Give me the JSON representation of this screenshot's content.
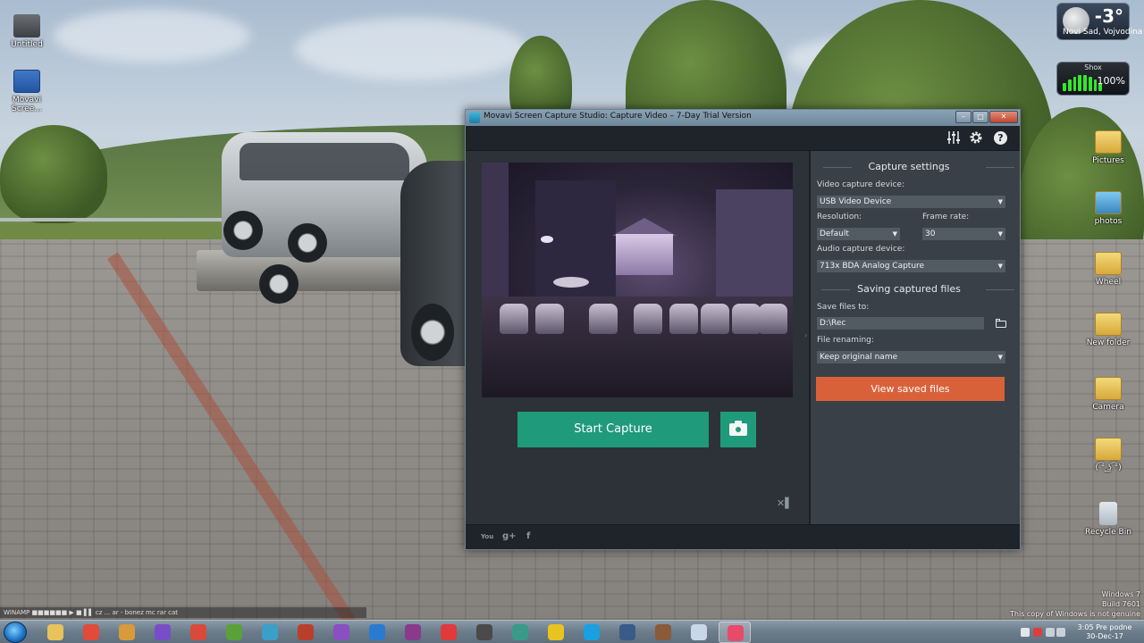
{
  "desktop": {
    "icons_left": [
      {
        "label": "Untitled",
        "kind": "shortcut"
      },
      {
        "label": "Movavi Scree...",
        "kind": "shortcut"
      }
    ],
    "icons_right": [
      {
        "label": "Pictures",
        "kind": "folder"
      },
      {
        "label": "photos",
        "kind": "folder"
      },
      {
        "label": "Wheel",
        "kind": "folder"
      },
      {
        "label": "New folder",
        "kind": "folder"
      },
      {
        "label": "Camera",
        "kind": "folder"
      },
      {
        "label": "( ͡° ͜ʖ ͡°)",
        "kind": "folder"
      },
      {
        "label": "Recycle Bin",
        "kind": "bin"
      }
    ]
  },
  "gadgets": {
    "weather": {
      "temp": "-3°",
      "city": "Novi Sad, Vojvodina"
    },
    "shox": {
      "title": "Shox",
      "level_percent": 100,
      "label": "100%"
    }
  },
  "window": {
    "title": "Movavi Screen Capture Studio: Capture Video – 7-Day Trial Version",
    "controls": {
      "minimize": "–",
      "maximize": "□",
      "close": "✕"
    },
    "toolbar_icons": [
      "equalizer-icon",
      "gear-icon",
      "help-icon"
    ],
    "help_glyph": "?",
    "preview": {
      "controls": {
        "start_capture": "Start Capture"
      }
    },
    "capture_settings": {
      "title": "Capture settings",
      "video_device_label": "Video capture device:",
      "video_device_value": "USB Video Device",
      "resolution_label": "Resolution:",
      "resolution_value": "Default",
      "frame_rate_label": "Frame rate:",
      "frame_rate_value": "30",
      "audio_device_label": "Audio capture device:",
      "audio_device_value": "713x BDA Analog Capture"
    },
    "saving": {
      "title": "Saving captured files",
      "save_to_label": "Save files to:",
      "save_to_value": "D:\\Rec",
      "renaming_label": "File renaming:",
      "renaming_value": "Keep original name",
      "view_saved": "View saved files"
    },
    "status_icons": [
      "youtube-icon",
      "google-plus-icon",
      "facebook-icon"
    ],
    "status_glyphs": {
      "youtube": "You",
      "google_plus": "g+",
      "facebook": "f"
    },
    "collapse_glyph": "✕▌",
    "splitter_glyph": "›",
    "dropdown_arrow": "▼"
  },
  "taskbar": {
    "ghost_text": "WINAMP   ■■■■■■   ▶  ■  ▌▌        cz ... ar - bonez mc rar cat",
    "clock_time": "3:05 Pre podne",
    "clock_date": "30-Dec-17",
    "genuine_lines": [
      "Windows 7",
      "Build 7601",
      "This copy of Windows is not genuine"
    ],
    "apps": [
      {
        "name": "explorer-icon",
        "color": "#e8c25a"
      },
      {
        "name": "chrome-icon",
        "color": "#e24a3b"
      },
      {
        "name": "tool-icon",
        "color": "#d89a3a"
      },
      {
        "name": "viber-icon",
        "color": "#7a4dc8"
      },
      {
        "name": "popcorn-icon",
        "color": "#d94a3a"
      },
      {
        "name": "utorrent-icon",
        "color": "#5aa13a"
      },
      {
        "name": "xbox-icon",
        "color": "#3aa0c8"
      },
      {
        "name": "game-icon",
        "color": "#b8402a"
      },
      {
        "name": "y-app-icon",
        "color": "#8a4fc0"
      },
      {
        "name": "lightning-icon",
        "color": "#2a7ad0"
      },
      {
        "name": "winrar-icon",
        "color": "#8a3a8a"
      },
      {
        "name": "speed-icon",
        "color": "#e03a3a"
      },
      {
        "name": "ark-icon",
        "color": "#4a4a4a"
      },
      {
        "name": "media-icon",
        "color": "#3a9a8a"
      },
      {
        "name": "radiation-icon",
        "color": "#e8c420"
      },
      {
        "name": "skype-icon",
        "color": "#1aa0e0"
      },
      {
        "name": "monitor-icon",
        "color": "#3a5a8a"
      },
      {
        "name": "face-icon",
        "color": "#8a5a3a"
      },
      {
        "name": "paint-icon",
        "color": "#c8d8e8"
      },
      {
        "name": "movavi-icon",
        "color": "#e84a6a"
      }
    ]
  }
}
